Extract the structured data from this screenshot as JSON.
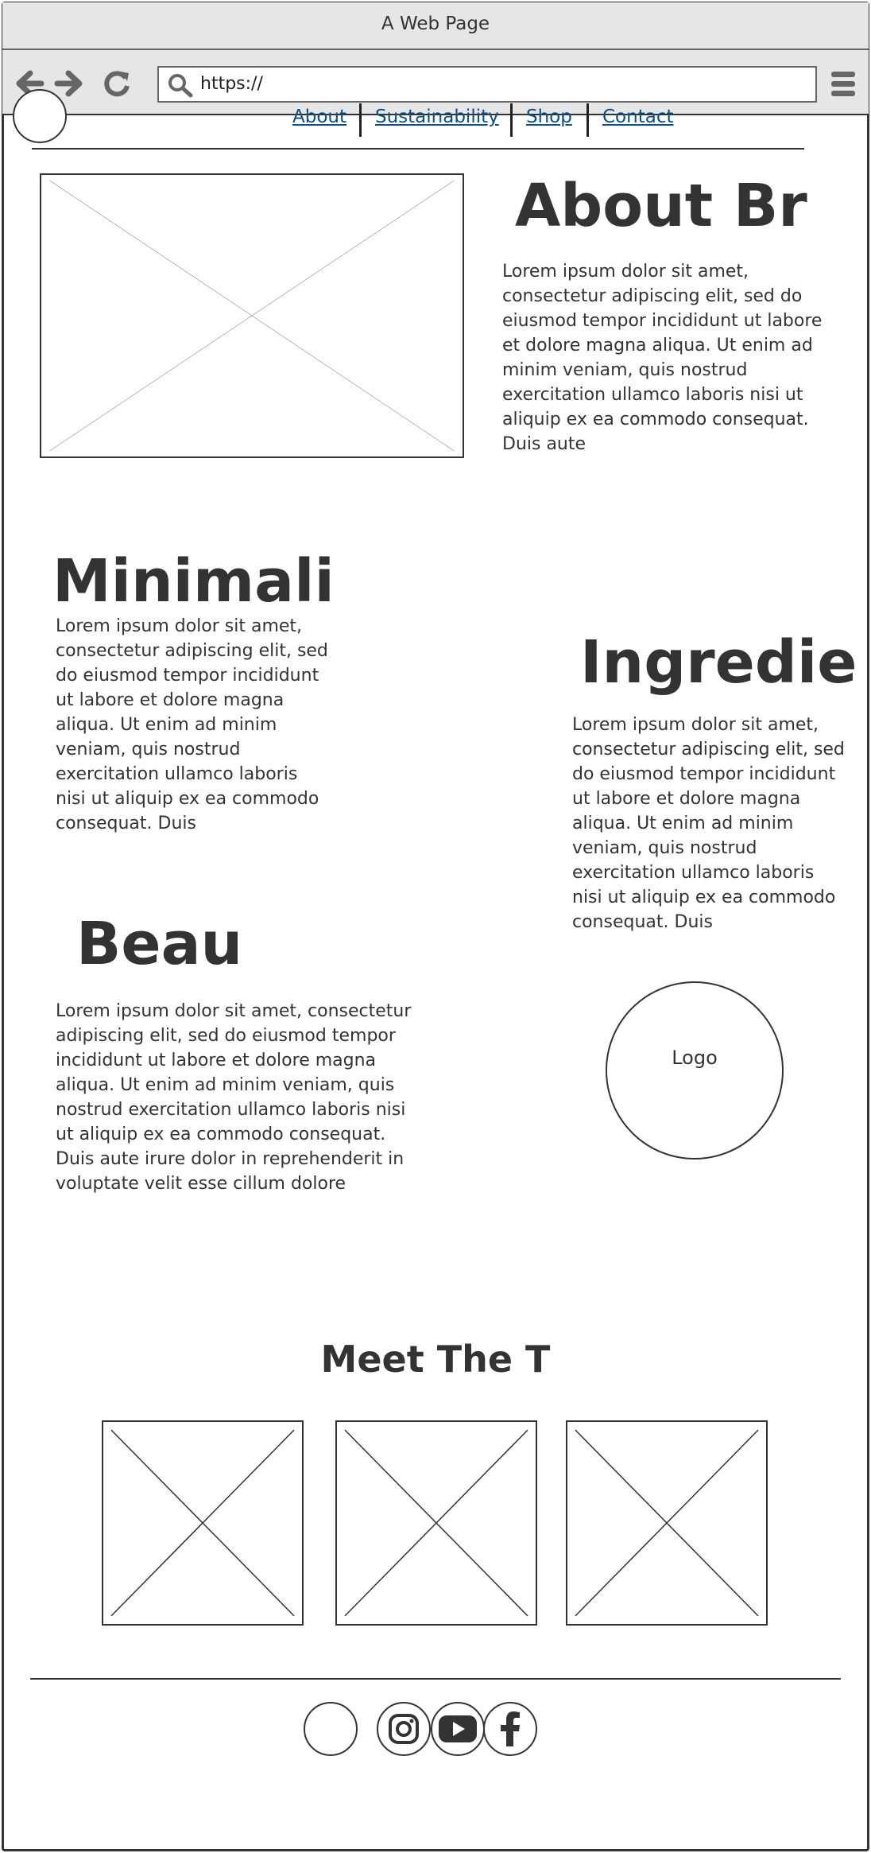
{
  "window": {
    "title": "A Web Page"
  },
  "browser": {
    "url": "https://",
    "icons": [
      "back-arrow-icon",
      "forward-arrow-icon",
      "reload-icon",
      "search-icon",
      "hamburger-menu-icon"
    ]
  },
  "nav": {
    "links": [
      "About",
      "Sustainability",
      "Shop",
      "Contact"
    ]
  },
  "about": {
    "heading": "About Br",
    "text": "Lorem ipsum dolor sit amet, consectetur adipiscing elit, sed do eiusmod tempor incididunt ut labore et dolore magna aliqua. Ut enim ad minim veniam, quis nostrud exercitation ullamco laboris nisi ut aliquip ex ea commodo consequat. Duis aute"
  },
  "minimal": {
    "heading": "Minimali",
    "text": "Lorem ipsum dolor sit amet, consectetur adipiscing elit, sed do eiusmod tempor incididunt ut labore et dolore magna aliqua. Ut enim ad minim veniam, quis nostrud exercitation ullamco laboris nisi ut aliquip ex ea commodo consequat. Duis"
  },
  "ingredients": {
    "heading": "Ingredie",
    "text": "Lorem ipsum dolor sit amet, consectetur adipiscing elit, sed do eiusmod tempor incididunt ut labore et dolore magna aliqua. Ut enim ad minim veniam, quis nostrud exercitation ullamco laboris nisi ut aliquip ex ea commodo consequat. Duis"
  },
  "beauty": {
    "heading": "Beau",
    "text": "Lorem ipsum dolor sit amet, consectetur adipiscing elit, sed do eiusmod tempor incididunt ut labore et dolore magna aliqua. Ut enim ad minim veniam, quis nostrud exercitation ullamco laboris nisi ut aliquip ex ea commodo consequat. Duis aute irure dolor in reprehenderit in voluptate velit esse cillum dolore"
  },
  "logo": {
    "label": "Logo"
  },
  "team": {
    "heading": "Meet The T"
  },
  "footer": {
    "social": [
      "instagram-icon",
      "youtube-icon",
      "facebook-icon"
    ]
  }
}
